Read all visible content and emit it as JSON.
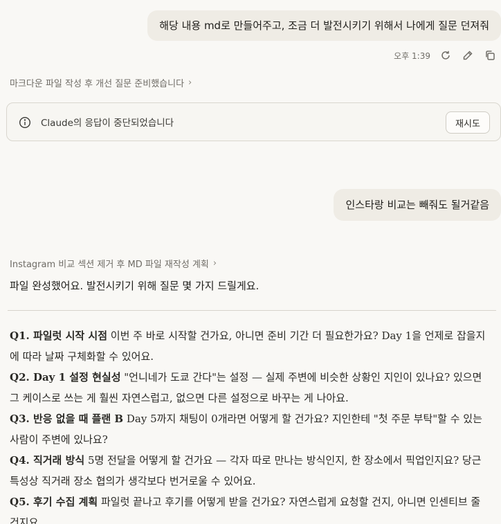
{
  "user_messages": [
    "해당 내용 md로 만들어주고, 조금 더 발전시키기 위해서 나에게 질문 던져줘",
    "인스타랑 비교는 빼줘도 될거같음"
  ],
  "message_meta": {
    "time": "오후 1:39"
  },
  "thinking": [
    {
      "label": "마크다운 파일 작성 후 개선 질문 준비했습니다",
      "chevron": "›"
    },
    {
      "label": "Instagram 비교 섹션 제거 후 MD 파일 재작성 계획",
      "chevron": "›"
    }
  ],
  "error": {
    "text": "Claude의 응답이 중단되었습니다",
    "retry_label": "재시도"
  },
  "reply": {
    "intro": "파일 완성했어요. 발전시키기 위해 질문 몇 가지 드릴게요.",
    "questions": [
      {
        "title": "Q1. 파일럿 시작 시점",
        "body": " 이번 주 바로 시작할 건가요, 아니면 준비 기간 더 필요한가요? Day 1을 언제로 잡을지에 따라 날짜 구체화할 수 있어요."
      },
      {
        "title": "Q2. Day 1 설정 현실성",
        "body": " \"언니네가 도쿄 간다\"는 설정 — 실제 주변에 비슷한 상황인 지인이 있나요? 있으면 그 케이스로 쓰는 게 훨씬 자연스럽고, 없으면 다른 설정으로 바꾸는 게 나아요."
      },
      {
        "title": "Q3. 반응 없을 때 플랜 B",
        "body": " Day 5까지 채팅이 0개라면 어떻게 할 건가요? 지인한테 \"첫 주문 부탁\"할 수 있는 사람이 주변에 있나요?"
      },
      {
        "title": "Q4. 직거래 방식",
        "body": " 5명 전달을 어떻게 할 건가요 — 각자 따로 만나는 방식인지, 한 장소에서 픽업인지요? 당근 특성상 직거래 장소 협의가 생각보다 번거로울 수 있어요."
      },
      {
        "title": "Q5. 후기 수집 계획",
        "body": " 파일럿 끝나고 후기를 어떻게 받을 건가요? 자연스럽게 요청할 건지, 아니면 인센티브 줄 건지요."
      }
    ]
  }
}
